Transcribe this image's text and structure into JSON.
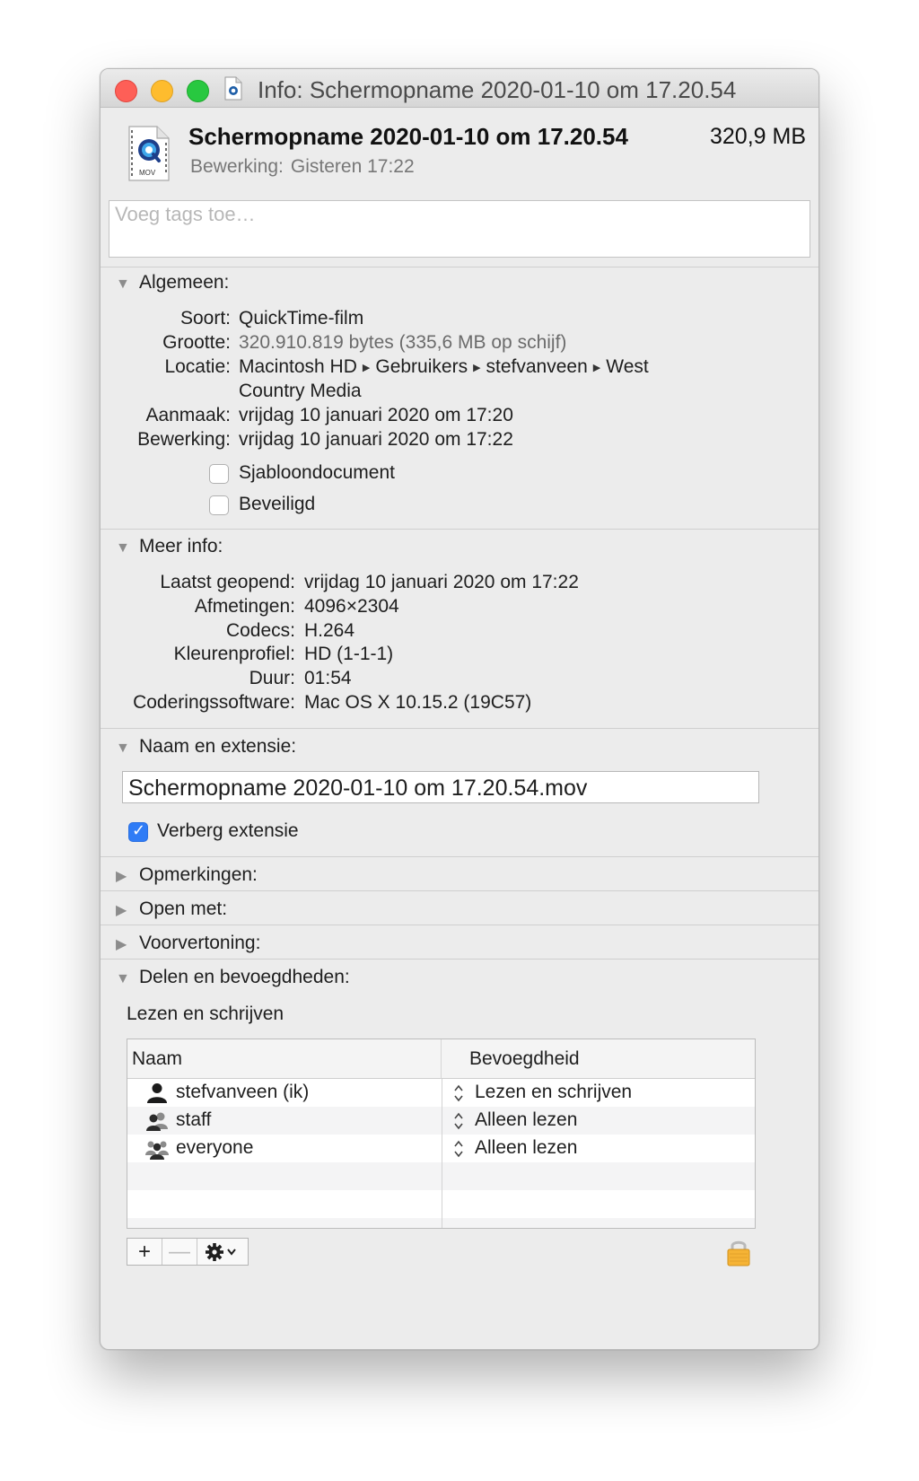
{
  "window": {
    "title": "Info: Schermopname 2020-01-10 om 17.20.54"
  },
  "header": {
    "file_name": "Schermopname 2020-01-10 om 17.20.54",
    "file_size": "320,9 MB",
    "modified_label": "Bewerking:",
    "modified_value": "Gisteren 17:22",
    "icon_badge": "MOV",
    "icon": "quicktime-movie-file-icon"
  },
  "tags": {
    "placeholder": "Voeg tags toe…"
  },
  "general": {
    "title": "Algemeen:",
    "kind_label": "Soort:",
    "kind_value": "QuickTime-film",
    "size_label": "Grootte:",
    "size_bytes": "320.910.819 bytes",
    "size_disk": "(335,6 MB op schijf)",
    "location_label": "Locatie:",
    "location_path": [
      "Macintosh HD",
      "Gebruikers",
      "stefvanveen",
      "West"
    ],
    "location_cont": "Country Media",
    "created_label": "Aanmaak:",
    "created_value": "vrijdag 10 januari 2020 om 17:20",
    "modified_label": "Bewerking:",
    "modified_value": "vrijdag 10 januari 2020 om 17:22",
    "stationery_label": "Sjabloondocument",
    "stationery_checked": false,
    "locked_label": "Beveiligd",
    "locked_checked": false
  },
  "more_info": {
    "title": "Meer info:",
    "last_opened_label": "Laatst geopend:",
    "last_opened_value": "vrijdag 10 januari 2020 om 17:22",
    "dimensions_label": "Afmetingen:",
    "dimensions_value": "4096×2304",
    "codecs_label": "Codecs:",
    "codecs_value": "H.264",
    "color_profile_label": "Kleurenprofiel:",
    "color_profile_value": "HD (1-1-1)",
    "duration_label": "Duur:",
    "duration_value": "01:54",
    "encoder_label": "Coderingssoftware:",
    "encoder_value": "Mac OS X 10.15.2 (19C57)"
  },
  "name_ext": {
    "title": "Naam en extensie:",
    "value": "Schermopname 2020-01-10 om 17.20.54.mov",
    "hide_ext_label": "Verberg extensie",
    "hide_ext_checked": true
  },
  "comments": {
    "title": "Opmerkingen:"
  },
  "open_with": {
    "title": "Open met:"
  },
  "preview": {
    "title": "Voorvertoning:"
  },
  "sharing": {
    "title": "Delen en bevoegdheden:",
    "status": "Lezen en schrijven",
    "col_name": "Naam",
    "col_privilege": "Bevoegdheid",
    "rows": [
      {
        "name": "stefvanveen (ik)",
        "privilege": "Lezen en schrijven",
        "icon": "single-user-icon"
      },
      {
        "name": "staff",
        "privilege": "Alleen lezen",
        "icon": "group-icon"
      },
      {
        "name": "everyone",
        "privilege": "Alleen lezen",
        "icon": "everyone-icon"
      }
    ],
    "add_glyph": "+",
    "remove_glyph": "—"
  },
  "colors": {
    "close": "#fe5f57",
    "minimize": "#febc2e",
    "maximize": "#28c840",
    "checkbox_accent": "#2f7cf6",
    "lock": "#f5b335"
  }
}
